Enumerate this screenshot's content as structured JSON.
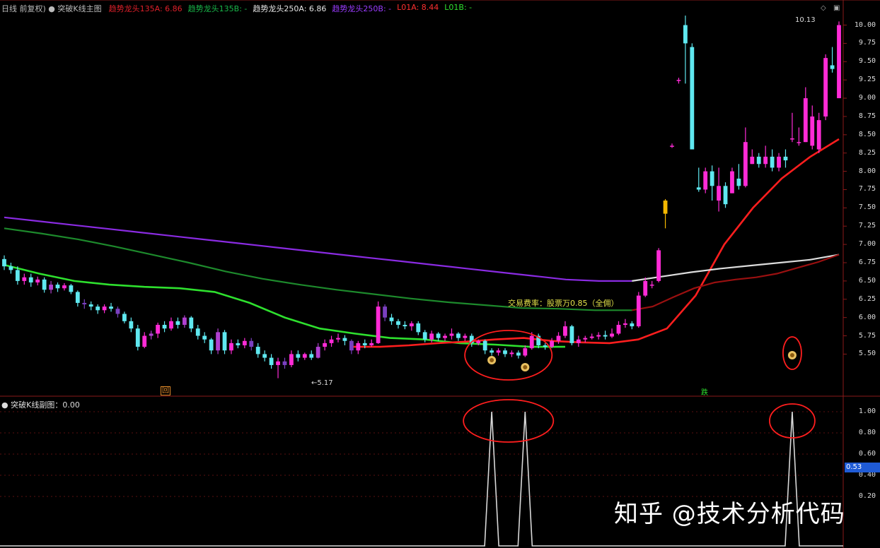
{
  "main_panel": {
    "title_prefix": "日线 前复权",
    "indicator_name": "突破K线主图",
    "legend": [
      {
        "label": "趋势龙头135A: 6.86",
        "color": "#e0202a"
      },
      {
        "label": "趋势龙头135B: -",
        "color": "#19b84a"
      },
      {
        "label": "趋势龙头250A: 6.86",
        "color": "#e6e6e6"
      },
      {
        "label": "趋势龙头250B: -",
        "color": "#9b3cff"
      },
      {
        "label": "L01A: 8.44",
        "color": "#ff3030"
      },
      {
        "label": "L01B: -",
        "color": "#2ee02e"
      }
    ],
    "annotation": "交易费率：股票万0.85（全佣）",
    "high_label": "10.13",
    "low_label": "5.17",
    "marker_left": "回",
    "marker_right": "跌"
  },
  "sub_panel": {
    "title": "突破K线副图：0.00",
    "current_value": "0.53"
  },
  "watermark": "知乎 @技术分析代码",
  "chart_data": [
    {
      "type": "candlestick",
      "title": "突破K线主图",
      "ylim": [
        5.0,
        10.2
      ],
      "yticks": [
        "10.00",
        "9.75",
        "9.50",
        "9.25",
        "9.00",
        "8.75",
        "8.50",
        "8.25",
        "8.00",
        "7.75",
        "7.50",
        "7.25",
        "7.00",
        "6.75",
        "6.50",
        "6.25",
        "6.00",
        "5.75",
        "5.50"
      ],
      "candles": [
        [
          6.8,
          6.7,
          6.85,
          6.65
        ],
        [
          6.7,
          6.65,
          6.75,
          6.6
        ],
        [
          6.65,
          6.5,
          6.7,
          6.45
        ],
        [
          6.5,
          6.55,
          6.6,
          6.45
        ],
        [
          6.55,
          6.48,
          6.6,
          6.42
        ],
        [
          6.48,
          6.52,
          6.56,
          6.44
        ],
        [
          6.52,
          6.38,
          6.55,
          6.34
        ],
        [
          6.38,
          6.45,
          6.5,
          6.33
        ],
        [
          6.45,
          6.4,
          6.48,
          6.35
        ],
        [
          6.4,
          6.44,
          6.47,
          6.37
        ],
        [
          6.44,
          6.35,
          6.46,
          6.32
        ],
        [
          6.35,
          6.2,
          6.37,
          6.15
        ],
        [
          6.2,
          6.18,
          6.25,
          6.12
        ],
        [
          6.18,
          6.15,
          6.22,
          6.1
        ],
        [
          6.15,
          6.1,
          6.18,
          6.05
        ],
        [
          6.1,
          6.15,
          6.18,
          6.06
        ],
        [
          6.15,
          6.12,
          6.2,
          6.08
        ],
        [
          6.12,
          6.05,
          6.15,
          6.0
        ],
        [
          6.05,
          5.95,
          6.08,
          5.92
        ],
        [
          5.95,
          5.85,
          6.0,
          5.8
        ],
        [
          5.85,
          5.6,
          5.9,
          5.55
        ],
        [
          5.6,
          5.75,
          5.8,
          5.58
        ],
        [
          5.75,
          5.78,
          5.82,
          5.7
        ],
        [
          5.78,
          5.9,
          5.93,
          5.72
        ],
        [
          5.9,
          5.85,
          5.95,
          5.8
        ],
        [
          5.85,
          5.95,
          6.0,
          5.82
        ],
        [
          5.95,
          5.9,
          6.0,
          5.85
        ],
        [
          5.9,
          6.0,
          6.03,
          5.86
        ],
        [
          6.0,
          5.85,
          6.02,
          5.8
        ],
        [
          5.85,
          5.75,
          5.9,
          5.7
        ],
        [
          5.75,
          5.7,
          5.8,
          5.65
        ],
        [
          5.7,
          5.55,
          5.72,
          5.5
        ],
        [
          5.55,
          5.8,
          5.85,
          5.5
        ],
        [
          5.8,
          5.55,
          5.83,
          5.5
        ],
        [
          5.55,
          5.65,
          5.7,
          5.5
        ],
        [
          5.65,
          5.62,
          5.7,
          5.58
        ],
        [
          5.62,
          5.68,
          5.72,
          5.58
        ],
        [
          5.68,
          5.6,
          5.72,
          5.55
        ],
        [
          5.6,
          5.5,
          5.65,
          5.45
        ],
        [
          5.5,
          5.45,
          5.55,
          5.4
        ],
        [
          5.45,
          5.35,
          5.5,
          5.3
        ],
        [
          5.35,
          5.4,
          5.45,
          5.17
        ],
        [
          5.4,
          5.35,
          5.45,
          5.3
        ],
        [
          5.35,
          5.5,
          5.55,
          5.32
        ],
        [
          5.5,
          5.45,
          5.55,
          5.4
        ],
        [
          5.45,
          5.5,
          5.52,
          5.42
        ],
        [
          5.5,
          5.45,
          5.55,
          5.42
        ],
        [
          5.45,
          5.6,
          5.65,
          5.44
        ],
        [
          5.6,
          5.65,
          5.7,
          5.55
        ],
        [
          5.65,
          5.7,
          5.75,
          5.6
        ],
        [
          5.7,
          5.72,
          5.78,
          5.66
        ],
        [
          5.72,
          5.68,
          5.76,
          5.62
        ],
        [
          5.68,
          5.55,
          5.7,
          5.5
        ],
        [
          5.55,
          5.65,
          5.68,
          5.5
        ],
        [
          5.65,
          5.62,
          5.7,
          5.58
        ],
        [
          5.62,
          5.65,
          5.7,
          5.6
        ],
        [
          5.65,
          6.15,
          6.22,
          5.64
        ],
        [
          6.15,
          6.0,
          6.18,
          5.95
        ],
        [
          6.0,
          5.95,
          6.05,
          5.9
        ],
        [
          5.95,
          5.9,
          5.98,
          5.85
        ],
        [
          5.9,
          5.88,
          5.95,
          5.84
        ],
        [
          5.88,
          5.92,
          5.95,
          5.82
        ],
        [
          5.92,
          5.8,
          5.95,
          5.76
        ],
        [
          5.8,
          5.7,
          5.83,
          5.66
        ],
        [
          5.7,
          5.78,
          5.82,
          5.66
        ],
        [
          5.78,
          5.72,
          5.8,
          5.68
        ],
        [
          5.72,
          5.75,
          5.78,
          5.68
        ],
        [
          5.75,
          5.78,
          5.85,
          5.7
        ],
        [
          5.78,
          5.72,
          5.8,
          5.68
        ],
        [
          5.72,
          5.75,
          5.78,
          5.68
        ],
        [
          5.75,
          5.65,
          5.78,
          5.6
        ],
        [
          5.65,
          5.68,
          5.7,
          5.62
        ],
        [
          5.68,
          5.55,
          5.7,
          5.5
        ],
        [
          5.55,
          5.52,
          5.58,
          5.48
        ],
        [
          5.52,
          5.55,
          5.58,
          5.48
        ],
        [
          5.55,
          5.5,
          5.58,
          5.46
        ],
        [
          5.5,
          5.52,
          5.55,
          5.46
        ],
        [
          5.52,
          5.48,
          5.55,
          5.44
        ],
        [
          5.48,
          5.58,
          5.62,
          5.46
        ],
        [
          5.58,
          5.75,
          5.8,
          5.56
        ],
        [
          5.75,
          5.62,
          5.78,
          5.58
        ],
        [
          5.62,
          5.6,
          5.65,
          5.56
        ],
        [
          5.6,
          5.68,
          5.72,
          5.58
        ],
        [
          5.68,
          5.75,
          5.8,
          5.64
        ],
        [
          5.75,
          5.88,
          5.95,
          5.72
        ],
        [
          5.88,
          5.65,
          5.9,
          5.62
        ],
        [
          5.65,
          5.7,
          5.75,
          5.6
        ],
        [
          5.7,
          5.72,
          5.75,
          5.66
        ],
        [
          5.72,
          5.74,
          5.78,
          5.7
        ],
        [
          5.74,
          5.76,
          5.8,
          5.7
        ],
        [
          5.76,
          5.74,
          5.82,
          5.7
        ],
        [
          5.74,
          5.78,
          5.85,
          5.72
        ],
        [
          5.78,
          5.9,
          5.95,
          5.76
        ],
        [
          5.9,
          5.92,
          5.98,
          5.86
        ],
        [
          5.92,
          5.88,
          5.95,
          5.84
        ],
        [
          5.88,
          6.3,
          6.35,
          5.86
        ],
        [
          6.3,
          6.5,
          6.55,
          6.28
        ],
        [
          6.45,
          6.45,
          6.5,
          6.4
        ],
        [
          6.5,
          6.92,
          6.95,
          6.48
        ],
        [
          7.6,
          7.42,
          7.62,
          7.22
        ],
        [
          8.35,
          8.35,
          8.38,
          8.32
        ],
        [
          9.25,
          9.25,
          9.28,
          9.2
        ],
        [
          10.0,
          9.75,
          10.13,
          9.2
        ],
        [
          9.7,
          8.3,
          9.75,
          8.3
        ],
        [
          7.78,
          7.75,
          8.05,
          7.72
        ],
        [
          7.75,
          8.0,
          8.05,
          7.7
        ],
        [
          8.0,
          7.8,
          8.08,
          7.6
        ],
        [
          7.6,
          7.8,
          8.05,
          7.45
        ],
        [
          7.8,
          7.55,
          7.85,
          7.5
        ],
        [
          7.7,
          8.0,
          8.05,
          7.7
        ],
        [
          7.9,
          7.8,
          8.1,
          7.75
        ],
        [
          7.8,
          8.4,
          8.6,
          7.78
        ],
        [
          8.1,
          8.2,
          8.3,
          8.1
        ],
        [
          8.2,
          8.1,
          8.25,
          8.05
        ],
        [
          8.1,
          8.2,
          8.35,
          8.05
        ],
        [
          8.2,
          8.05,
          8.3,
          8.0
        ],
        [
          8.05,
          8.2,
          8.25,
          8.0
        ],
        [
          8.2,
          8.15,
          8.3,
          8.05
        ],
        [
          8.45,
          8.45,
          8.8,
          8.4
        ],
        [
          8.4,
          8.4,
          8.6,
          8.35
        ],
        [
          8.4,
          9.0,
          9.15,
          8.4
        ],
        [
          8.35,
          8.75,
          8.9,
          8.3
        ],
        [
          8.3,
          8.7,
          8.8,
          8.25
        ],
        [
          8.75,
          9.55,
          9.6,
          8.7
        ],
        [
          9.45,
          9.4,
          9.7,
          9.35
        ],
        [
          9.0,
          10.0,
          10.05,
          9.0
        ]
      ],
      "series": [
        {
          "name": "趋势龙头250B",
          "color": "#8a2be2",
          "values": [
            7.37,
            7.32,
            7.27,
            7.22,
            7.17,
            7.12,
            7.07,
            7.02,
            6.97,
            6.92,
            6.87,
            6.82,
            6.77,
            6.72,
            6.67,
            6.62,
            6.57,
            6.52,
            6.5,
            6.5
          ]
        },
        {
          "name": "趋势龙头135B",
          "color": "#1d8a2c",
          "values": [
            7.22,
            7.15,
            7.07,
            6.97,
            6.86,
            6.75,
            6.63,
            6.53,
            6.45,
            6.38,
            6.32,
            6.26,
            6.21,
            6.17,
            6.13,
            6.12,
            6.1,
            6.1
          ]
        },
        {
          "name": "L01B",
          "color": "#2ee02e",
          "values": [
            6.72,
            6.6,
            6.5,
            6.45,
            6.42,
            6.4,
            6.35,
            6.2,
            6.0,
            5.85,
            5.78,
            5.72,
            5.7,
            5.65,
            5.63,
            5.6,
            5.6
          ]
        },
        {
          "name": "L01A",
          "color": "#ff1e1e",
          "values": [
            5.6,
            5.6,
            5.62,
            5.65,
            5.67,
            5.7,
            5.72,
            5.68,
            5.66,
            5.65,
            5.7,
            5.85,
            6.3,
            7.0,
            7.5,
            7.9,
            8.2,
            8.44
          ]
        },
        {
          "name": "趋势龙头250A",
          "color": "#dcdcdc",
          "values": [
            6.5,
            6.56,
            6.62,
            6.67,
            6.71,
            6.75,
            6.79,
            6.86
          ]
        },
        {
          "name": "趋势龙头135A",
          "color": "#9a1010",
          "values": [
            6.1,
            6.15,
            6.28,
            6.4,
            6.48,
            6.52,
            6.55,
            6.6,
            6.68,
            6.76,
            6.86
          ]
        }
      ]
    },
    {
      "type": "line",
      "title": "突破K线副图",
      "ylim": [
        0,
        1.1
      ],
      "yticks": [
        "1.00",
        "0.80",
        "0.60",
        "0.40",
        "0.20"
      ],
      "spikes_at_candle": [
        73,
        78,
        118
      ],
      "spike_value": 1.0
    }
  ]
}
